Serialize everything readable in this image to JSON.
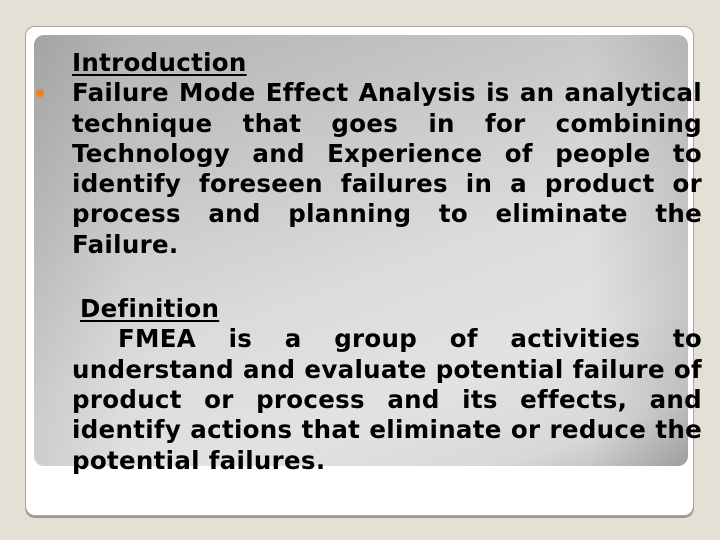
{
  "slide": {
    "intro_heading": "Introduction",
    "intro_bullet_icon": "orange-dot-bullet",
    "intro_text": "Failure Mode Effect Analysis is an analytical technique that goes in for combining Technology and Experience of people to identify foreseen failures in a product or process and planning to eliminate the Failure.",
    "definition_heading": "Definition",
    "definition_text": "FMEA is a group of activities to understand and evaluate potential failure of product or process and its effects, and identify actions that eliminate or reduce the potential failures."
  },
  "colors": {
    "background": "#E5E0D6",
    "bullet": "#F0801C",
    "text": "#000000"
  }
}
